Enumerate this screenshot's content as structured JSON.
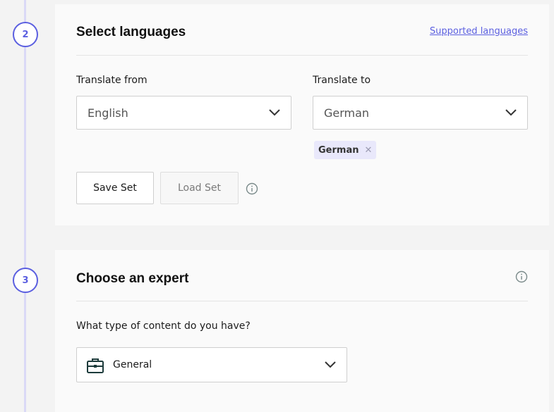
{
  "steps": [
    {
      "number": "2"
    },
    {
      "number": "3"
    }
  ],
  "languages": {
    "title": "Select languages",
    "supported_link": "Supported languages",
    "from_label": "Translate from",
    "from_value": "English",
    "to_label": "Translate to",
    "to_value": "German",
    "selected_chips": [
      "German"
    ],
    "save_label": "Save Set",
    "load_label": "Load Set"
  },
  "expert": {
    "title": "Choose an expert",
    "question": "What type of content do you have?",
    "value": "General",
    "value_icon": "briefcase-icon"
  },
  "colors": {
    "accent": "#5b5fe0",
    "chip_bg": "#e9e8fb",
    "rail": "#dad9f6"
  }
}
